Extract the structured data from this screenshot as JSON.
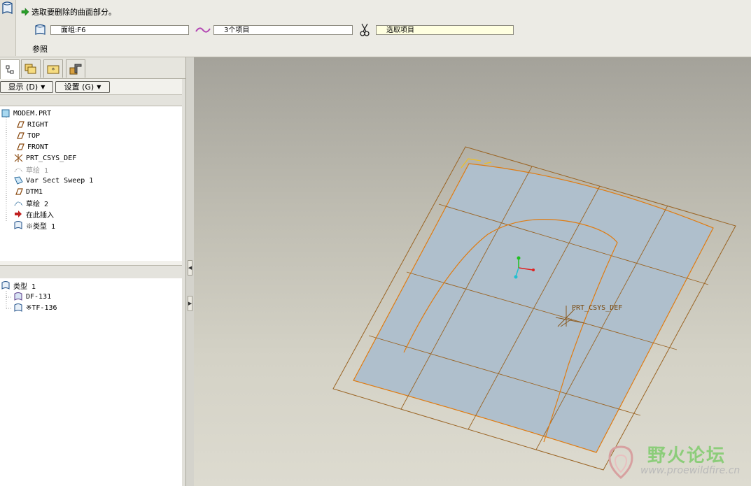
{
  "dashboard": {
    "prompt": "选取要删除的曲面部分。",
    "quilt_field": "面组:F6",
    "curves_field": "3个项目",
    "trim_field": "选取项目",
    "reference_label": "参照"
  },
  "left_panel": {
    "show_button": "显示 (D)",
    "settings_button": "设置 (G)",
    "model_tree": [
      {
        "label": "MODEM.PRT",
        "icon": "part-icon",
        "state": "normal"
      },
      {
        "label": "RIGHT",
        "icon": "datum-plane-icon",
        "state": "normal"
      },
      {
        "label": "TOP",
        "icon": "datum-plane-icon",
        "state": "normal"
      },
      {
        "label": "FRONT",
        "icon": "datum-plane-icon",
        "state": "normal"
      },
      {
        "label": "PRT_CSYS_DEF",
        "icon": "csys-icon",
        "state": "normal"
      },
      {
        "label": "草绘 1",
        "icon": "sketch-icon",
        "state": "grey"
      },
      {
        "label": "Var Sect Sweep 1",
        "icon": "sweep-icon",
        "state": "normal"
      },
      {
        "label": "DTM1",
        "icon": "datum-plane-icon",
        "state": "normal"
      },
      {
        "label": "草绘 2",
        "icon": "sketch-icon",
        "state": "normal"
      },
      {
        "label": "在此插入",
        "icon": "insert-here-arrow-icon",
        "state": "normal"
      },
      {
        "label": "※类型 1",
        "icon": "quilt-icon",
        "state": "normal"
      }
    ],
    "detail_tree": [
      {
        "label": "类型 1",
        "icon": "quilt-icon"
      },
      {
        "label": "DF-131",
        "icon": "surface-icon"
      },
      {
        "label": "※TF-136",
        "icon": "surface-icon"
      }
    ]
  },
  "graphics": {
    "csys_label": "PRT_CSYS_DEF"
  },
  "watermark": {
    "text": "野火论坛",
    "url": "www.proewildfire.cn"
  },
  "colors": {
    "accent_orange": "#e07b10",
    "surface_fill": "#afbfcc",
    "datum_line": "#9a6424",
    "prompt_arrow": "#2aa02a"
  }
}
